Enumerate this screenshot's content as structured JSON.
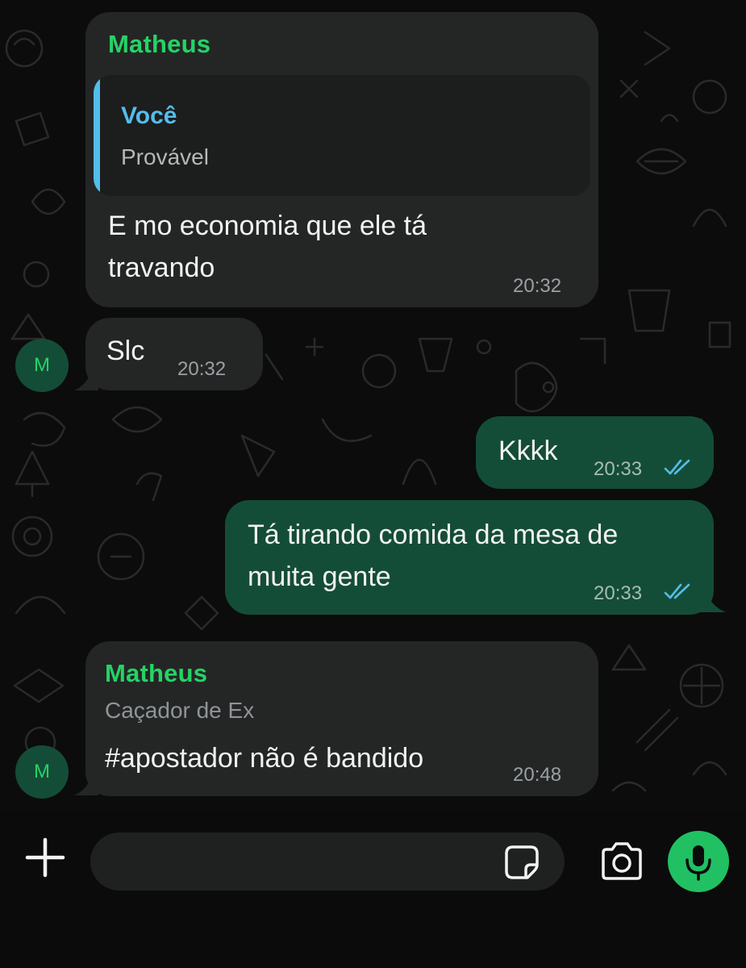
{
  "colors": {
    "background": "#0c0c0c",
    "incoming_bubble": "#242626",
    "outgoing_bubble": "#144d37",
    "sender_name": "#25d366",
    "quote_accent": "#53bdeb",
    "read_ticks": "#53bdeb",
    "mic_button": "#21c063"
  },
  "messages": [
    {
      "sender": "Matheus",
      "quote": {
        "author": "Você",
        "text": "Provável"
      },
      "text_lines": [
        "E mo economia que ele tá",
        "travando"
      ],
      "time": "20:32"
    },
    {
      "avatar_letter": "M",
      "text": "Slc",
      "time": "20:32"
    },
    {
      "text": "Kkkk",
      "time": "20:33",
      "status": "read"
    },
    {
      "text_lines": [
        "Tá tirando comida da mesa de",
        "muita gente"
      ],
      "time": "20:33",
      "status": "read"
    },
    {
      "sender": "Matheus",
      "subtitle": "Caçador de Ex",
      "avatar_letter": "M",
      "text": "#apostador não é bandido",
      "time": "20:48"
    }
  ],
  "composer": {
    "plus_icon": "plus-icon",
    "input_value": "",
    "sticker_icon": "sticker-icon",
    "camera_icon": "camera-icon",
    "mic_icon": "microphone-icon"
  }
}
